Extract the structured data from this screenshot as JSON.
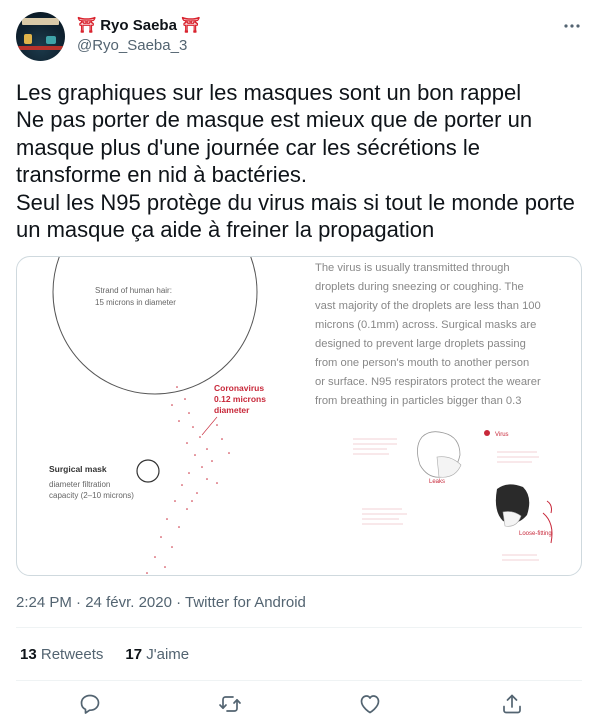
{
  "author": {
    "name": "Ryo Saeba",
    "name_prefix": "⛩",
    "name_suffix": "⛩",
    "handle": "@Ryo_Saeba_3"
  },
  "tweet": {
    "text": "Les graphiques sur les masques sont un bon rappel\nNe pas porter de masque est mieux que de porter un masque plus d'une journée car les sécrétions le transforme en nid à bactéries.\nSeul les N95 protège du virus mais si tout le monde porte un masque ça aide à freiner la propagation"
  },
  "media": {
    "hair_label": "Strand of human hair:",
    "hair_size": "15 microns in diameter",
    "virus_label_1": "Coronavirus",
    "virus_label_2": "0.12 microns",
    "virus_label_3": "diameter",
    "mask_title": "Surgical mask",
    "mask_line1": "diameter filtration",
    "mask_line2": "capacity (2–10 microns)",
    "paragraph": [
      "The virus is usually transmitted through",
      "droplets during sneezing or coughing. The",
      "vast majority of the droplets are less than 100",
      "microns (0.1mm) across. Surgical masks are",
      "designed to prevent large droplets passing",
      "from one person's mouth to another person",
      "or surface. N95 respirators protect the wearer",
      "from breathing in particles bigger than 0.3"
    ],
    "fig_label_leaks": "Leaks",
    "fig_label_virus": "Virus",
    "fig_label_loose": "Loose-fitting"
  },
  "meta": {
    "time": "2:24 PM",
    "sep1": " · ",
    "date": "24 févr. 2020",
    "sep2": " · ",
    "source": "Twitter for Android"
  },
  "stats": {
    "retweets_count": "13",
    "retweets_label": "Retweets",
    "likes_count": "17",
    "likes_label": "J'aime"
  },
  "colors": {
    "accent_red": "#c8283a",
    "secondary_text": "#536471"
  }
}
